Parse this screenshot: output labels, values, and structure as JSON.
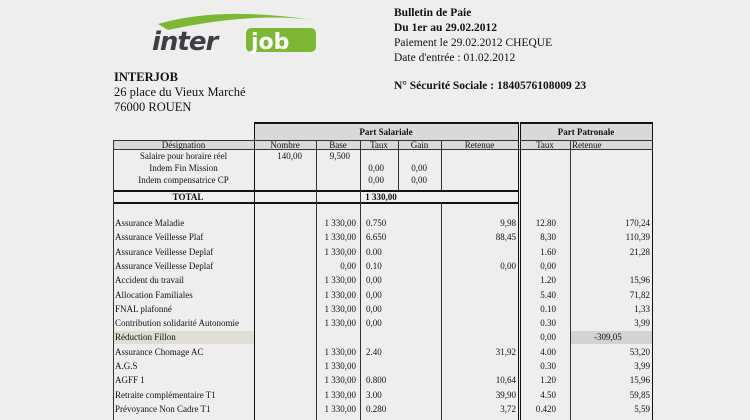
{
  "logo": {
    "text_inter": "inter",
    "text_job": "job",
    "colors": {
      "inter": "#3e3f44",
      "job": "#7cb833",
      "swoosh": "#7cb833"
    }
  },
  "company": {
    "name": "INTERJOB",
    "address_line1": "26 place du Vieux Marché",
    "address_line2": "76000 ROUEN"
  },
  "header": {
    "title": "Bulletin de Paie",
    "period": "Du 1er au 29.02.2012",
    "payment": "Paiement le 29.02.2012 CHEQUE",
    "entry_date": "Date d'entrée : 01.02.2012",
    "social_security": "N° Sécurité Sociale : 1840576108009 23"
  },
  "table": {
    "group_salariale": "Part Salariale",
    "group_patronale": "Part Patronale",
    "columns": {
      "designation": "Désignation",
      "nombre": "Nombre",
      "base": "Base",
      "taux": "Taux",
      "gain": "Gain",
      "retenue": "Retenue",
      "p_taux": "Taux",
      "p_retenue": "Retenue"
    },
    "top_rows": [
      {
        "designation": "Salaire pour horaire réel",
        "nombre": "140,00",
        "base": "9,500",
        "taux": "",
        "gain": ""
      },
      {
        "designation": "Indem Fin Mission",
        "nombre": "",
        "base": "",
        "taux": "0,00",
        "gain": "0,00"
      },
      {
        "designation": "Indem compensatrice CP",
        "nombre": "",
        "base": "",
        "taux": "0,00",
        "gain": "0,00"
      }
    ],
    "total_label": "TOTAL",
    "total_value": "1 330,00",
    "rows": [
      {
        "designation": "Assurance Maladie",
        "base": "1 330,00",
        "taux": "0.750",
        "retenue": "9,98",
        "p_taux": "12.80",
        "p_retenue": "170,24"
      },
      {
        "designation": "Assurance Veillesse Plaf",
        "base": "1 330,00",
        "taux": "6.650",
        "retenue": "88,45",
        "p_taux": "8,30",
        "p_retenue": "110,39"
      },
      {
        "designation": "Assurance Veillesse Deplaf",
        "base": "1 330,00",
        "taux": "0.00",
        "retenue": "",
        "p_taux": "1.60",
        "p_retenue": "21,28"
      },
      {
        "designation": "Assurance Veillesse Deplaf",
        "base": "0,00",
        "taux": "0.10",
        "retenue": "0,00",
        "p_taux": "0,00",
        "p_retenue": ""
      },
      {
        "designation": "Accident du travail",
        "base": "1 330,00",
        "taux": "0,00",
        "retenue": "",
        "p_taux": "1.20",
        "p_retenue": "15,96"
      },
      {
        "designation": "Allocation Familiales",
        "base": "1 330,00",
        "taux": "0,00",
        "retenue": "",
        "p_taux": "5.40",
        "p_retenue": "71,82"
      },
      {
        "designation": "FNAL plafonné",
        "base": "1 330,00",
        "taux": "0,00",
        "retenue": "",
        "p_taux": "0.10",
        "p_retenue": "1,33"
      },
      {
        "designation": "Contribution solidarité Autonomie",
        "base": "1 330,00",
        "taux": "0,00",
        "retenue": "",
        "p_taux": "0.30",
        "p_retenue": "3,99"
      },
      {
        "designation": "Réduction Fillon",
        "base": "",
        "taux": "",
        "retenue": "",
        "p_taux": "0,00",
        "p_retenue": "-309,05",
        "highlight": true
      },
      {
        "designation": "Assurance Chomage AC",
        "base": "1 330,00",
        "taux": "2.40",
        "retenue": "31,92",
        "p_taux": "4.00",
        "p_retenue": "53,20"
      },
      {
        "designation": "A.G.S",
        "base": "1 330,00",
        "taux": "",
        "retenue": "",
        "p_taux": "0.30",
        "p_retenue": "3,99"
      },
      {
        "designation": "AGFF 1",
        "base": "1 330,00",
        "taux": "0.800",
        "retenue": "10,64",
        "p_taux": "1.20",
        "p_retenue": "15,96"
      },
      {
        "designation": "Retraite complémentaire T1",
        "base": "1 330,00",
        "taux": "3.00",
        "retenue": "39,90",
        "p_taux": "4.50",
        "p_retenue": "59,85"
      },
      {
        "designation": "Prévoyance Non Cadre T1",
        "base": "1 330,00",
        "taux": "0.280",
        "retenue": "3,72",
        "p_taux": "0.420",
        "p_retenue": "5,59"
      }
    ]
  }
}
